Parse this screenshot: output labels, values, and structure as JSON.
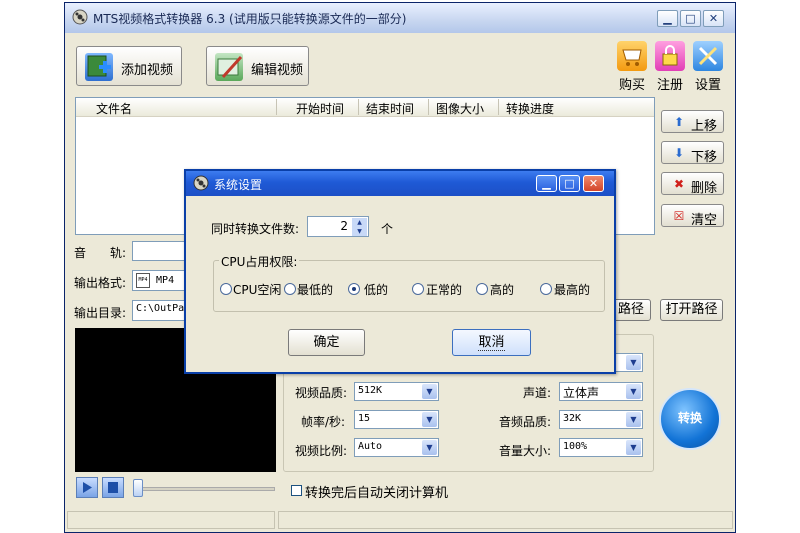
{
  "window": {
    "title": "MTS视频格式转换器 6.3 (试用版只能转换源文件的一部分)",
    "controls": [
      "minimize-icon",
      "maximize-icon",
      "close-icon"
    ]
  },
  "toolbar": {
    "add_video": "添加视频",
    "edit_video": "编辑视频",
    "buy": "购买",
    "register": "注册",
    "settings": "设置"
  },
  "file_list": {
    "columns": [
      "文件名",
      "开始时间",
      "结束时间",
      "图像大小",
      "转换进度"
    ],
    "rows": []
  },
  "side_buttons": {
    "move_up": "上移",
    "move_down": "下移",
    "delete": "删除",
    "clear": "清空"
  },
  "audio_track": {
    "label": "音　　轨:",
    "value": ""
  },
  "output_format": {
    "label": "输出格式:",
    "value": "MP4"
  },
  "output_dir": {
    "label": "输出目录:",
    "value": "C:\\OutPa",
    "browse_label": "路径",
    "open_label": "打开路径"
  },
  "params": {
    "video_quality": {
      "label": "视频品质:",
      "value": "512K"
    },
    "frame_rate": {
      "label": "帧率/秒:",
      "value": "15"
    },
    "aspect_ratio": {
      "label": "视频比例:",
      "value": "Auto"
    },
    "channels": {
      "label": "声道:",
      "value": "立体声"
    },
    "audio_quality": {
      "label": "音频品质:",
      "value": "32K"
    },
    "volume": {
      "label": "音量大小:",
      "value": "100%"
    }
  },
  "convert_button": "转换",
  "shutdown_checkbox": {
    "label": "转换完后自动关闭计算机",
    "checked": false
  },
  "dialog": {
    "title": "系统设置",
    "concurrent_label": "同时转换文件数:",
    "concurrent_value": "2",
    "concurrent_unit": "个",
    "cpu_group_label": "CPU占用权限:",
    "cpu_options": [
      "CPU空闲",
      "最低的",
      "低的",
      "正常的",
      "高的",
      "最高的"
    ],
    "cpu_selected": "低的",
    "ok_label": "确定",
    "cancel_label": "取消"
  }
}
